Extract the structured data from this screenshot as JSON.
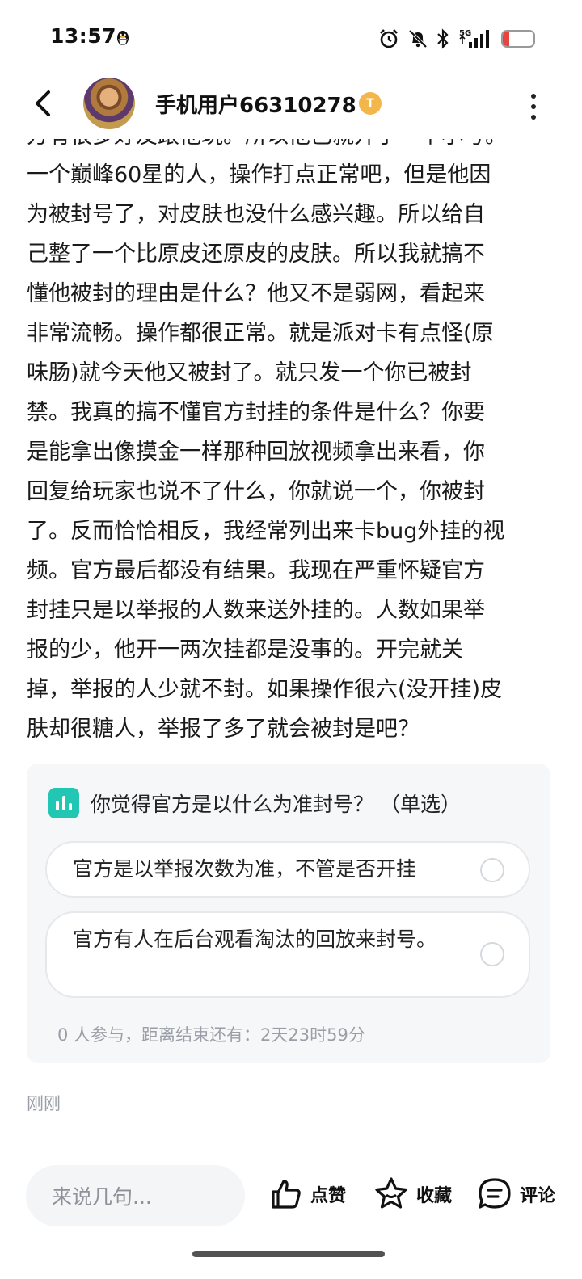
{
  "status_bar": {
    "time": "13:57",
    "network": "5G",
    "battery": "20",
    "battery_level_percent": 20,
    "icons": [
      "qq-penguin-icon",
      "alarm-icon",
      "mute-bell-icon",
      "bluetooth-icon",
      "signal-icon",
      "battery-icon"
    ]
  },
  "header": {
    "username": "手机用户66310278",
    "badge": "T",
    "icons": [
      "back-arrow-icon",
      "avatar",
      "level-badge-icon",
      "more-vertical-icon"
    ]
  },
  "article": {
    "cut_line": "方有很多好友跟他玩。所以他已就开了一个小号。",
    "lines": [
      "一个巅峰60星的人，操作打点正常吧，但是他因",
      "为被封号了，对皮肤也没什么感兴趣。所以给自",
      "己整了一个比原皮还原皮的皮肤。所以我就搞不",
      "懂他被封的理由是什么？他又不是弱网，看起来",
      "非常流畅。操作都很正常。就是派对卡有点怪(原",
      "味肠)就今天他又被封了。就只发一个你已被封",
      "禁。我真的搞不懂官方封挂的条件是什么？你要",
      "是能拿出像摸金一样那种回放视频拿出来看，你",
      "回复给玩家也说不了什么，你就说一个，你被封",
      "了。反而恰恰相反，我经常列出来卡bug外挂的视",
      "频。官方最后都没有结果。我现在严重怀疑官方",
      "封挂只是以举报的人数来送外挂的。人数如果举",
      "报的少，他开一两次挂都是没事的。开完就关",
      "掉，举报的人少就不封。如果操作很六(没开挂)皮",
      "肤却很糖人，举报了多了就会被封是吧？"
    ]
  },
  "poll": {
    "icon": "poll-chart-icon",
    "title": "你觉得官方是以什么为准封号？ （单选）",
    "options": [
      {
        "label": "官方是以举报次数为准，不管是否开挂",
        "selected": false
      },
      {
        "label": "官方有人在后台观看淘汰的回放来封号。",
        "selected": false
      }
    ],
    "footer": "0 人参与，距离结束还有：2天23时59分"
  },
  "timestamp": "刚刚",
  "bottom_bar": {
    "comment_placeholder": "来说几句...",
    "like_label": "点赞",
    "favorite_label": "收藏",
    "comment_label": "评论"
  },
  "colors": {
    "accent_teal": "#21c7b3",
    "battery_red": "#e8433d",
    "badge_gold": "#f2b64a",
    "muted_text": "#9a9ea6"
  }
}
